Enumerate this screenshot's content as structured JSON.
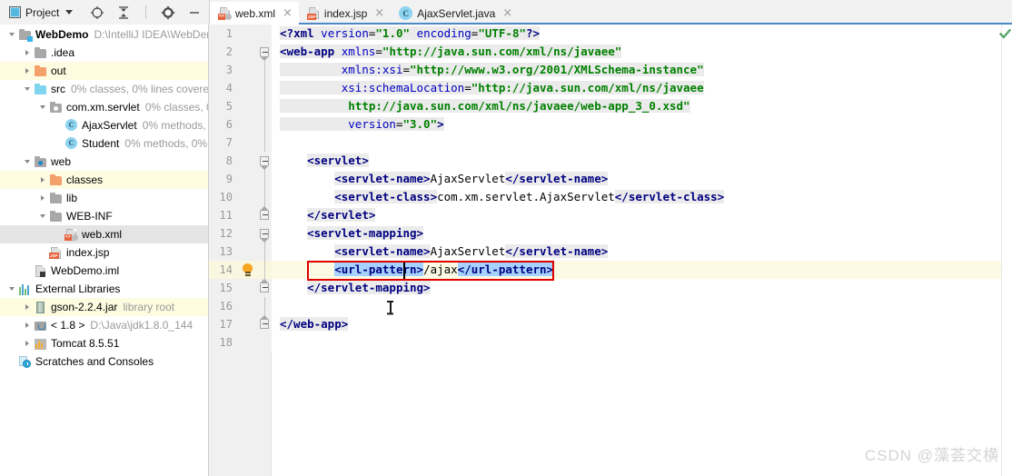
{
  "toolbar": {
    "panel_title": "Project",
    "icons": [
      {
        "name": "locate-icon",
        "glyph": "target"
      },
      {
        "name": "collapse-all-icon",
        "glyph": "collapse"
      },
      {
        "name": "settings-gear-icon",
        "glyph": "gear"
      },
      {
        "name": "minimize-icon",
        "glyph": "dash"
      }
    ]
  },
  "tabs": [
    {
      "label": "web.xml",
      "icon": "xml-file-icon",
      "active": true,
      "close": "×"
    },
    {
      "label": "index.jsp",
      "icon": "jsp-file-icon",
      "active": false,
      "close": "×"
    },
    {
      "label": "AjaxServlet.java",
      "icon": "java-class-icon",
      "active": false,
      "close": "×"
    }
  ],
  "sidebar": {
    "items": [
      {
        "indent": 0,
        "arrow": "open",
        "icon": "module-folder-icon",
        "label": "WebDemo",
        "bold": true,
        "sub": "D:\\IntelliJ IDEA\\WebDem",
        "hl": ""
      },
      {
        "indent": 1,
        "arrow": "closed",
        "icon": "folder-gray-icon",
        "label": ".idea",
        "bold": false,
        "sub": "",
        "hl": ""
      },
      {
        "indent": 1,
        "arrow": "closed",
        "icon": "folder-orange-icon",
        "label": "out",
        "bold": false,
        "sub": "",
        "hl": "hl-yellow"
      },
      {
        "indent": 1,
        "arrow": "open",
        "icon": "folder-source-icon",
        "label": "src",
        "bold": false,
        "sub": "0% classes, 0% lines covered",
        "hl": ""
      },
      {
        "indent": 2,
        "arrow": "open",
        "icon": "package-icon",
        "label": "com.xm.servlet",
        "bold": false,
        "sub": "0% classes, 0",
        "hl": ""
      },
      {
        "indent": 3,
        "arrow": "none",
        "icon": "java-class-icon",
        "label": "AjaxServlet",
        "bold": false,
        "sub": "0% methods,",
        "hl": ""
      },
      {
        "indent": 3,
        "arrow": "none",
        "icon": "java-class-icon",
        "label": "Student",
        "bold": false,
        "sub": "0% methods, 0%",
        "hl": ""
      },
      {
        "indent": 1,
        "arrow": "open",
        "icon": "web-folder-icon",
        "label": "web",
        "bold": false,
        "sub": "",
        "hl": ""
      },
      {
        "indent": 2,
        "arrow": "closed",
        "icon": "folder-orange-icon",
        "label": "classes",
        "bold": false,
        "sub": "",
        "hl": "hl-yellow"
      },
      {
        "indent": 2,
        "arrow": "closed",
        "icon": "folder-gray-icon",
        "label": "lib",
        "bold": false,
        "sub": "",
        "hl": ""
      },
      {
        "indent": 2,
        "arrow": "open",
        "icon": "folder-gray-icon",
        "label": "WEB-INF",
        "bold": false,
        "sub": "",
        "hl": ""
      },
      {
        "indent": 3,
        "arrow": "none",
        "icon": "xml-file-icon",
        "label": "web.xml",
        "bold": false,
        "sub": "",
        "hl": "hl-sel"
      },
      {
        "indent": 2,
        "arrow": "none",
        "icon": "jsp-file-icon",
        "label": "index.jsp",
        "bold": false,
        "sub": "",
        "hl": ""
      },
      {
        "indent": 1,
        "arrow": "none",
        "icon": "iml-file-icon",
        "label": "WebDemo.iml",
        "bold": false,
        "sub": "",
        "hl": ""
      },
      {
        "indent": 0,
        "arrow": "open",
        "icon": "external-libraries-icon",
        "label": "External Libraries",
        "bold": false,
        "sub": "",
        "hl": ""
      },
      {
        "indent": 1,
        "arrow": "closed",
        "icon": "jar-icon",
        "label": "gson-2.2.4.jar",
        "bold": false,
        "sub": "library root",
        "hl": "hl-yellow"
      },
      {
        "indent": 1,
        "arrow": "closed",
        "icon": "jdk-icon",
        "label": "< 1.8 >",
        "bold": false,
        "sub": "D:\\Java\\jdk1.8.0_144",
        "hl": ""
      },
      {
        "indent": 1,
        "arrow": "closed",
        "icon": "tomcat-icon",
        "label": "Tomcat 8.5.51",
        "bold": false,
        "sub": "",
        "hl": ""
      },
      {
        "indent": 0,
        "arrow": "none",
        "icon": "scratches-icon",
        "label": "Scratches and Consoles",
        "bold": false,
        "sub": "",
        "hl": ""
      }
    ]
  },
  "editor": {
    "filename": "web.xml",
    "inspection_status": "ok",
    "lines": [
      {
        "num": "1",
        "fold": "none",
        "bulb": false,
        "hl": false,
        "tokens": [
          {
            "t": "<?",
            "c": "t-tag",
            "bg": "hlbg"
          },
          {
            "t": "xml",
            "c": "t-tag",
            "bg": "hlbg"
          },
          {
            "t": " ",
            "c": "t-plain",
            "bg": "hlbg"
          },
          {
            "t": "version",
            "c": "t-attr",
            "bg": "hlbg"
          },
          {
            "t": "=",
            "c": "t-plain",
            "bg": "hlbg"
          },
          {
            "t": "\"1.0\"",
            "c": "t-str",
            "bg": "hlbg"
          },
          {
            "t": " ",
            "c": "t-plain",
            "bg": "hlbg"
          },
          {
            "t": "encoding",
            "c": "t-attr",
            "bg": "hlbg"
          },
          {
            "t": "=",
            "c": "t-plain",
            "bg": "hlbg"
          },
          {
            "t": "\"UTF-8\"",
            "c": "t-str",
            "bg": "hlbg"
          },
          {
            "t": "?>",
            "c": "t-tag",
            "bg": "hlbg"
          }
        ]
      },
      {
        "num": "2",
        "fold": "top",
        "bulb": false,
        "hl": false,
        "tokens": [
          {
            "t": "<web-app",
            "c": "t-tag",
            "bg": "hlbg"
          },
          {
            "t": " ",
            "c": "t-plain",
            "bg": "hlbg"
          },
          {
            "t": "xmlns",
            "c": "t-attr",
            "bg": "hlbg"
          },
          {
            "t": "=",
            "c": "t-plain",
            "bg": "hlbg"
          },
          {
            "t": "\"http://java.sun.com/xml/ns/javaee\"",
            "c": "t-str",
            "bg": "hlbg"
          }
        ]
      },
      {
        "num": "3",
        "fold": "line",
        "bulb": false,
        "hl": false,
        "tokens": [
          {
            "t": "         ",
            "c": "t-plain",
            "bg": "hlbg"
          },
          {
            "t": "xmlns:xsi",
            "c": "t-attr",
            "bg": "hlbg"
          },
          {
            "t": "=",
            "c": "t-plain",
            "bg": "hlbg"
          },
          {
            "t": "\"http://www.w3.org/2001/XMLSchema-instance\"",
            "c": "t-str",
            "bg": "hlbg"
          }
        ]
      },
      {
        "num": "4",
        "fold": "line",
        "bulb": false,
        "hl": false,
        "tokens": [
          {
            "t": "         ",
            "c": "t-plain",
            "bg": "hlbg"
          },
          {
            "t": "xsi:schemaLocation",
            "c": "t-attr",
            "bg": "hlbg"
          },
          {
            "t": "=",
            "c": "t-plain",
            "bg": "hlbg"
          },
          {
            "t": "\"http://java.sun.com/xml/ns/javaee",
            "c": "t-str",
            "bg": "hlbg"
          }
        ]
      },
      {
        "num": "5",
        "fold": "line",
        "bulb": false,
        "hl": false,
        "tokens": [
          {
            "t": "          ",
            "c": "t-plain",
            "bg": "hlbg"
          },
          {
            "t": "http://java.sun.com/xml/ns/javaee/web-app_3_0.xsd\"",
            "c": "t-str",
            "bg": "hlbg"
          }
        ]
      },
      {
        "num": "6",
        "fold": "line",
        "bulb": false,
        "hl": false,
        "tokens": [
          {
            "t": "          ",
            "c": "t-plain",
            "bg": "hlbg"
          },
          {
            "t": "version",
            "c": "t-attr",
            "bg": "hlbg"
          },
          {
            "t": "=",
            "c": "t-plain",
            "bg": "hlbg"
          },
          {
            "t": "\"3.0\"",
            "c": "t-str",
            "bg": "hlbg"
          },
          {
            "t": ">",
            "c": "t-tag",
            "bg": "hlbg"
          }
        ]
      },
      {
        "num": "7",
        "fold": "line",
        "bulb": false,
        "hl": false,
        "tokens": []
      },
      {
        "num": "8",
        "fold": "top",
        "bulb": false,
        "hl": false,
        "tokens": [
          {
            "t": "    ",
            "c": "t-plain",
            "bg": ""
          },
          {
            "t": "<servlet>",
            "c": "t-tag",
            "bg": "hlbg"
          }
        ]
      },
      {
        "num": "9",
        "fold": "line",
        "bulb": false,
        "hl": false,
        "tokens": [
          {
            "t": "        ",
            "c": "t-plain",
            "bg": ""
          },
          {
            "t": "<servlet-name>",
            "c": "t-tag",
            "bg": "hlbg"
          },
          {
            "t": "AjaxServlet",
            "c": "t-txt",
            "bg": ""
          },
          {
            "t": "</servlet-name>",
            "c": "t-tag",
            "bg": "hlbg"
          }
        ]
      },
      {
        "num": "10",
        "fold": "line",
        "bulb": false,
        "hl": false,
        "tokens": [
          {
            "t": "        ",
            "c": "t-plain",
            "bg": ""
          },
          {
            "t": "<servlet-class>",
            "c": "t-tag",
            "bg": "hlbg"
          },
          {
            "t": "com.xm.servlet.AjaxServlet",
            "c": "t-txt",
            "bg": ""
          },
          {
            "t": "</servlet-class>",
            "c": "t-tag",
            "bg": "hlbg"
          }
        ]
      },
      {
        "num": "11",
        "fold": "bottom",
        "bulb": false,
        "hl": false,
        "tokens": [
          {
            "t": "    ",
            "c": "t-plain",
            "bg": ""
          },
          {
            "t": "</servlet>",
            "c": "t-tag",
            "bg": "hlbg"
          }
        ]
      },
      {
        "num": "12",
        "fold": "top",
        "bulb": false,
        "hl": false,
        "tokens": [
          {
            "t": "    ",
            "c": "t-plain",
            "bg": ""
          },
          {
            "t": "<servlet-mapping>",
            "c": "t-tag",
            "bg": "hlbg"
          }
        ]
      },
      {
        "num": "13",
        "fold": "line",
        "bulb": false,
        "hl": false,
        "tokens": [
          {
            "t": "        ",
            "c": "t-plain",
            "bg": ""
          },
          {
            "t": "<servlet-name>",
            "c": "t-tag",
            "bg": "hlbg"
          },
          {
            "t": "AjaxServlet",
            "c": "t-txt",
            "bg": ""
          },
          {
            "t": "</servlet-name>",
            "c": "t-tag",
            "bg": "hlbg"
          }
        ]
      },
      {
        "num": "14",
        "fold": "line",
        "bulb": true,
        "hl": true,
        "tokens": [
          {
            "t": "        ",
            "c": "t-plain",
            "bg": ""
          },
          {
            "t": "<url-pattern>",
            "c": "t-tag",
            "bg": "selbg"
          },
          {
            "t": "/ajax",
            "c": "t-txt",
            "bg": ""
          },
          {
            "t": "</url-pattern>",
            "c": "t-tag",
            "bg": "selbg"
          }
        ]
      },
      {
        "num": "15",
        "fold": "bottom",
        "bulb": false,
        "hl": false,
        "tokens": [
          {
            "t": "    ",
            "c": "t-plain",
            "bg": ""
          },
          {
            "t": "</servlet-mapping>",
            "c": "t-tag",
            "bg": "hlbg"
          }
        ]
      },
      {
        "num": "16",
        "fold": "line",
        "bulb": false,
        "hl": false,
        "tokens": []
      },
      {
        "num": "17",
        "fold": "bottom",
        "bulb": false,
        "hl": false,
        "tokens": [
          {
            "t": "</web-app>",
            "c": "t-tag",
            "bg": "hlbg"
          }
        ]
      },
      {
        "num": "18",
        "fold": "none",
        "bulb": false,
        "hl": false,
        "tokens": []
      }
    ]
  },
  "annotation": {
    "redbox_label": "url-pattern-highlight-box"
  },
  "watermark": {
    "text": "CSDN @藻荟交横"
  },
  "colors": {
    "accent_tab_underline": "#4a88c7",
    "selection_blue": "#a6d2ff",
    "line_highlight": "#fcfae3",
    "annotation_red": "#e00000",
    "tag_navy": "#000080",
    "string_green": "#008000",
    "attr_blue": "#0000c0",
    "excluded_folder_yellow": "#fdfce0"
  }
}
